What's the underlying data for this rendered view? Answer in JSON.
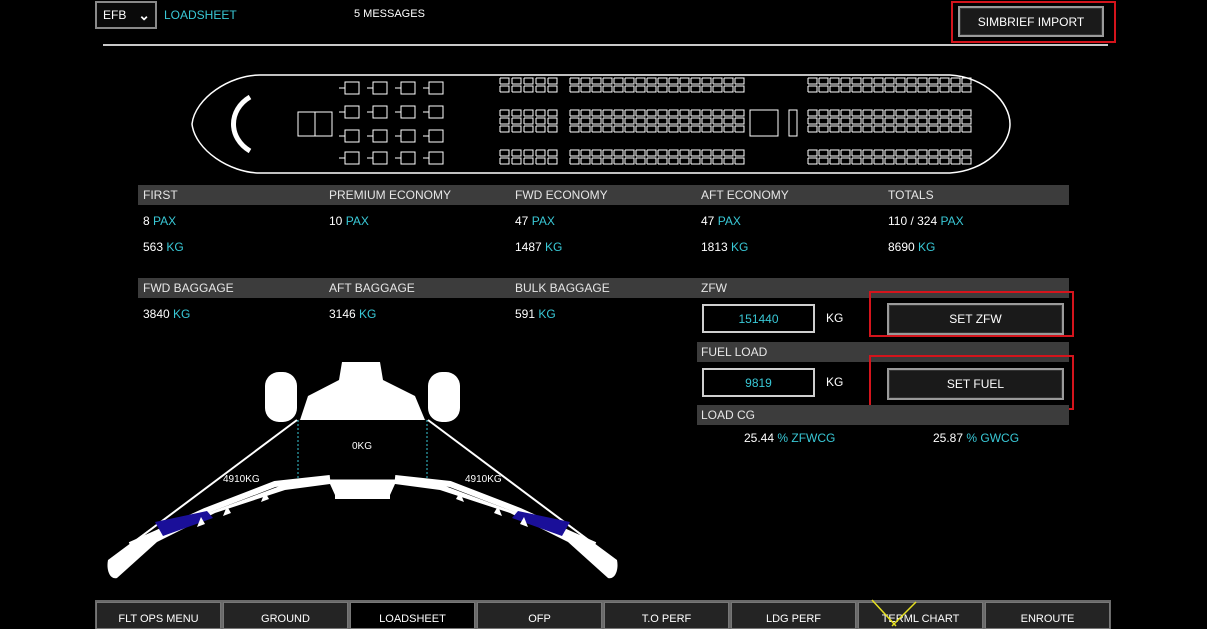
{
  "top": {
    "efb_value": "EFB",
    "page_title": "LOADSHEET",
    "messages": "5 MESSAGES",
    "simbrief_label": "SIMBRIEF IMPORT"
  },
  "pax": {
    "headers": [
      "FIRST",
      "PREMIUM ECONOMY",
      "FWD ECONOMY",
      "AFT ECONOMY",
      "TOTALS"
    ],
    "pax_values": [
      "8",
      "10",
      "47",
      "47",
      "110 / 324"
    ],
    "kg_values": [
      "563",
      "",
      "1487",
      "1813",
      "8690"
    ],
    "pax_unit": "PAX",
    "kg_unit": "KG"
  },
  "baggage": {
    "headers": [
      "FWD BAGGAGE",
      "AFT BAGGAGE",
      "BULK BAGGAGE"
    ],
    "values": [
      "3840",
      "3146",
      "591"
    ],
    "unit": "KG"
  },
  "zfw": {
    "label": "ZFW",
    "value": "151440",
    "unit": "KG",
    "button": "SET ZFW"
  },
  "fuel": {
    "label": "FUEL LOAD",
    "value": "9819",
    "unit": "KG",
    "button": "SET FUEL"
  },
  "cg": {
    "label": "LOAD CG",
    "zfwcg_value": "25.44",
    "zfwcg_unit": "% ZFWCG",
    "gwcg_value": "25.87",
    "gwcg_unit": "% GWCG"
  },
  "wing": {
    "center_tank": "0KG",
    "left_tank": "4910KG",
    "right_tank": "4910KG"
  },
  "nav": {
    "tabs": [
      "FLT OPS MENU",
      "GROUND",
      "LOADSHEET",
      "OFP",
      "T.O PERF",
      "LDG PERF",
      "TERML CHART",
      "ENROUTE"
    ],
    "active": "LOADSHEET"
  },
  "colors": {
    "accent": "#39c8d6",
    "highlight": "#d4141c",
    "header_bg": "#3c3c3c",
    "tank_fill": "#1a0f99"
  }
}
